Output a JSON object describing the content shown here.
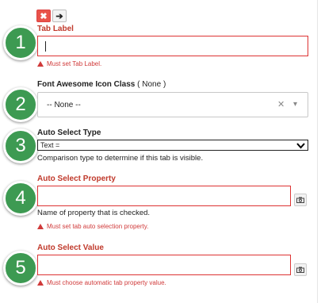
{
  "toolbar": {
    "close_glyph": "✖",
    "arrow_glyph": "➔"
  },
  "badges": [
    "1",
    "2",
    "3",
    "4",
    "5"
  ],
  "tab_label": {
    "label": "Tab Label",
    "value": "",
    "error": "Must set Tab Label."
  },
  "icon_class": {
    "label": "Font Awesome Icon Class",
    "extra": "( None )",
    "value": "-- None --",
    "clear_glyph": "✕",
    "caret_glyph": "▾"
  },
  "auto_select_type": {
    "label": "Auto Select Type",
    "value": "Text =",
    "options": [
      "Text ="
    ],
    "help": "Comparison type to determine if this tab is visible."
  },
  "auto_select_property": {
    "label": "Auto Select Property",
    "value": "",
    "help": "Name of property that is checked.",
    "error": "Must set tab auto selection property."
  },
  "auto_select_value": {
    "label": "Auto Select Value",
    "value": "",
    "error": "Must choose automatic tab property value."
  },
  "colors": {
    "badge": "#3d9a52",
    "error": "#d03a3a",
    "close_button": "#e9534a"
  },
  "icons": {
    "picker": "camera-icon",
    "warning": "warning-triangle-icon"
  }
}
